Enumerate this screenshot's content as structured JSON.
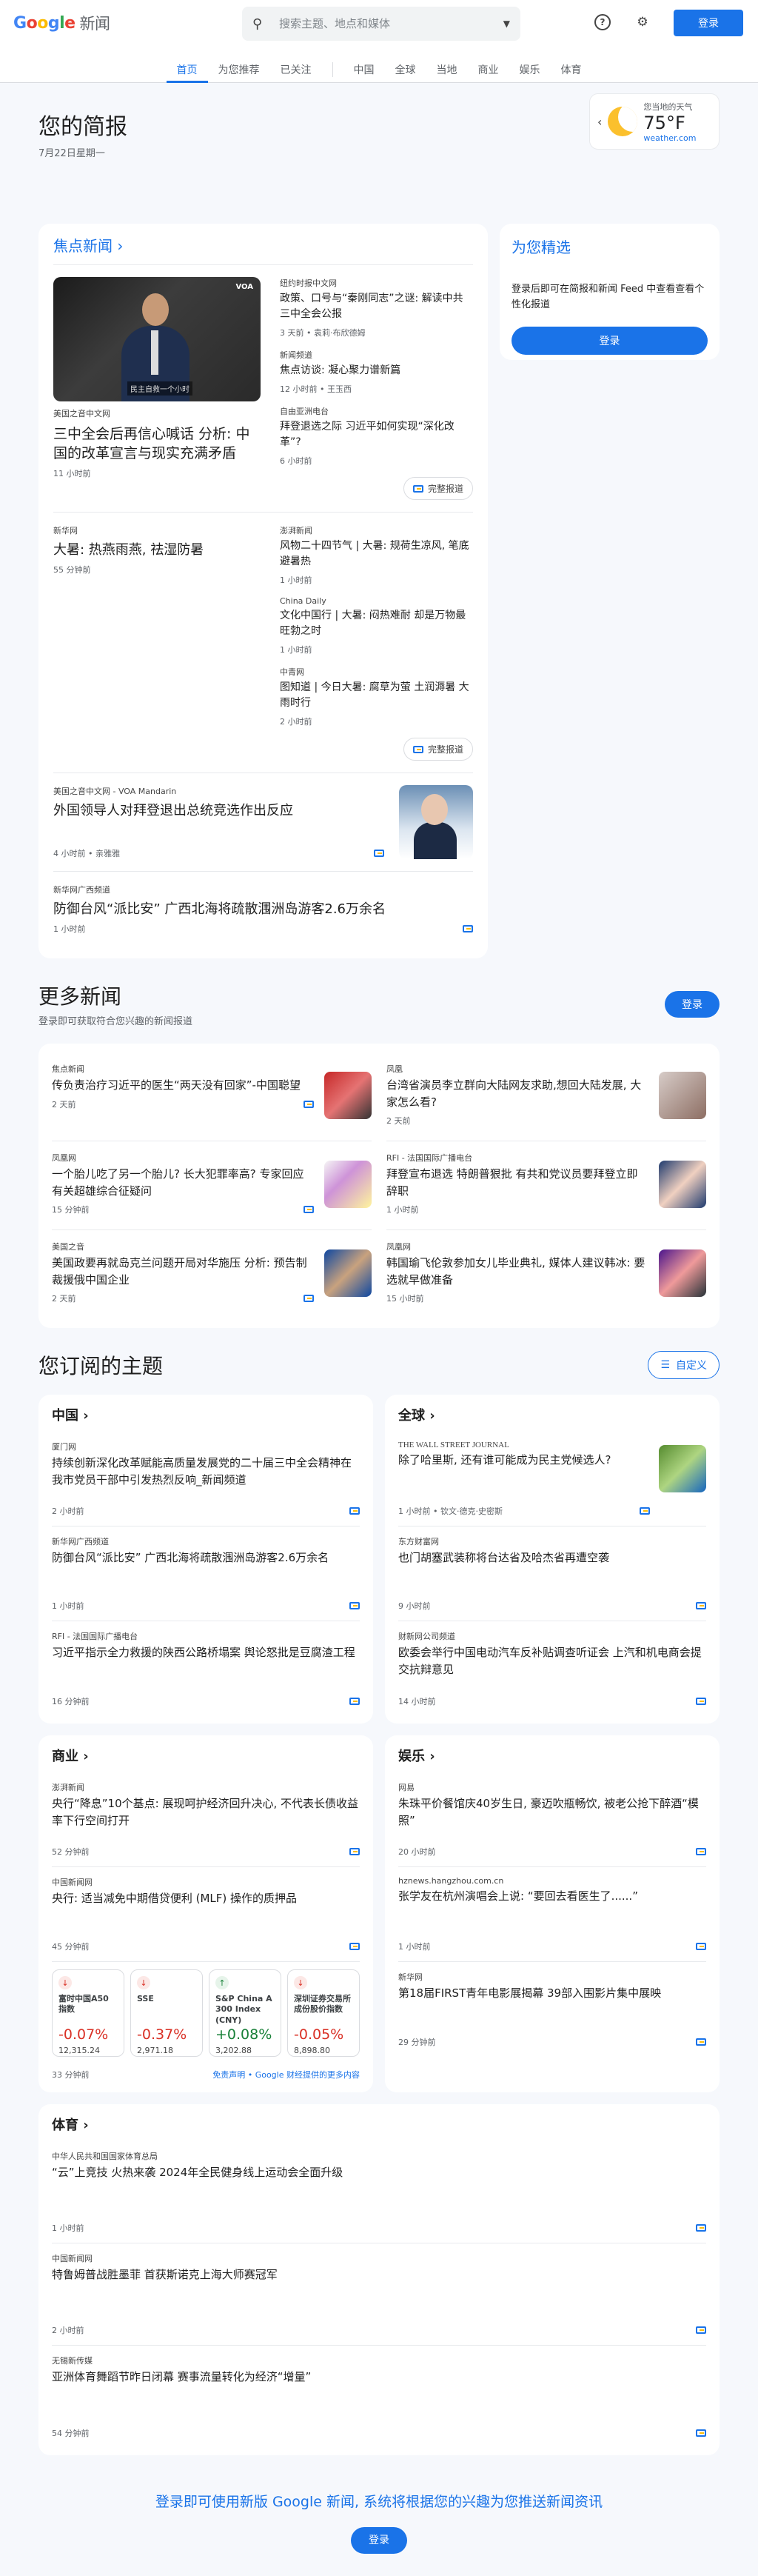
{
  "header": {
    "logo_google": "Google",
    "logo_news": "新闻",
    "search_placeholder": "搜索主题、地点和媒体",
    "login": "登录"
  },
  "nav": [
    {
      "label": "首页"
    },
    {
      "label": "为您推荐"
    },
    {
      "label": "已关注"
    },
    {
      "label": "中国"
    },
    {
      "label": "全球"
    },
    {
      "label": "当地"
    },
    {
      "label": "商业"
    },
    {
      "label": "娱乐"
    },
    {
      "label": "体育"
    }
  ],
  "briefing": {
    "title": "您的简报",
    "date": "7月22日星期一"
  },
  "weather": {
    "place": "您当地的天气",
    "temp": "75°F",
    "source": "weather.com"
  },
  "top": {
    "title": "焦点新闻",
    "c1": {
      "video_cap": "民主自救一个小时",
      "voa": "VOA",
      "main_src": "美国之音中文网",
      "main_hl": "三中全会后再信心喊话 分析: 中国的改革宣言与现实充满矛盾",
      "main_meta": "11 小时前",
      "s1_src": "纽约时报中文网",
      "s1_hl": "政策、口号与“秦刚同志”之谜: 解读中共三中全会公报",
      "s1_meta": "3 天前 • 袁莉·布欣德姆",
      "s2_src": "新闻频道",
      "s2_hl": "焦点访谈: 凝心聚力谱新篇",
      "s2_meta": "12 小时前 • 王玉西",
      "s3_src": "自由亚洲电台",
      "s3_hl": "拜登退选之际 习近平如何实现“深化改革”?",
      "s3_meta": "6 小时前",
      "full": "完整报道"
    },
    "c2": {
      "main_src": "新华网",
      "main_hl": "大暑: 热燕雨燕, 祛湿防暑",
      "main_meta": "55 分钟前",
      "s1_src": "澎湃新闻",
      "s1_hl": "风物二十四节气 | 大暑: 规荷生凉风, 笔底避暑热",
      "s1_meta": "1 小时前",
      "s2_src": "China Daily",
      "s2_hl": "文化中国行 | 大暑: 闷热难耐 却是万物最旺勃之时",
      "s2_meta": "1 小时前",
      "s3_src": "中青网",
      "s3_hl": "图知道 | 今日大暑: 腐草为萤 土润溽暑 大雨时行",
      "s3_meta": "2 小时前",
      "full": "完整报道"
    },
    "w1": {
      "src": "美国之音中文网 - VOA Mandarin",
      "hl": "外国领导人对拜登退出总统竞选作出反应",
      "meta": "4 小时前 • 亲雅雅"
    },
    "w2": {
      "src": "新华网广西频道",
      "hl": "防御台风“派比安” 广西北海将疏散涠洲岛游客2.6万余名",
      "meta": "1 小时前"
    }
  },
  "foryou": {
    "title": "为您精选",
    "text": "登录后即可在简报和新闻 Feed 中查看查看个性化报道",
    "btn": "登录"
  },
  "more": {
    "title": "更多新闻",
    "sub": "登录即可获取符合您兴趣的新闻报道",
    "btn": "登录",
    "items": [
      {
        "src": "焦点新闻",
        "hl": "传负责治疗习近平的医生“两天没有回家”-中国聪望",
        "meta": "2 天前"
      },
      {
        "src": "凤凰",
        "hl": "台湾省演员李立群向大陆网友求助,想回大陆发展, 大家怎么看?",
        "meta": "2 天前"
      },
      {
        "src": "凤凰网",
        "hl": "一个胎儿吃了另一个胎儿? 长大犯罪率高? 专家回应有关超雄综合征疑问",
        "meta": "15 分钟前"
      },
      {
        "src": "RFI - 法国国际广播电台",
        "hl": "拜登宣布退选 特朗普狠批 有共和党议员要拜登立即辞职",
        "meta": "1 小时前"
      },
      {
        "src": "美国之音",
        "hl": "美国政要再就岛克兰问题开局对华施压 分析: 预告制裁援俄中国企业",
        "meta": "2 天前"
      },
      {
        "src": "凤凰网",
        "hl": "韩国瑜飞伦敦参加女儿毕业典礼, 媒体人建议韩冰: 要选就早做准备",
        "meta": "15 小时前"
      }
    ]
  },
  "topics": {
    "title": "您订阅的主题",
    "customize": "自定义",
    "china": {
      "title": "中国",
      "items": [
        {
          "src": "厦门网",
          "hl": "持续创新深化改革赋能高质量发展党的二十届三中全会精神在我市党员干部中引发热烈反响_新闻频道",
          "meta": "2 小时前"
        },
        {
          "src": "新华网广西频道",
          "hl": "防御台风“派比安” 广西北海将疏散涠洲岛游客2.6万余名",
          "meta": "1 小时前"
        },
        {
          "src": "RFI - 法国国际广播电台",
          "hl": "习近平指示全力救援的陕西公路桥塌案 舆论怒批是豆腐渣工程",
          "meta": "16 分钟前"
        }
      ]
    },
    "global": {
      "title": "全球",
      "items": [
        {
          "src": "THE WALL STREET JOURNAL",
          "hl": "除了哈里斯, 还有谁可能成为民主党候选人?",
          "meta": "1 小时前 • 钦文·德克·史密斯"
        },
        {
          "src": "东方财富网",
          "hl": "也门胡塞武装称将台达省及哈杰省再遭空袭",
          "meta": "9 小时前"
        },
        {
          "src": "财新网公司频道",
          "hl": "欧委会举行中国电动汽车反补贴调查听证会 上汽和机电商会提交抗辩意见",
          "meta": "14 小时前"
        }
      ]
    },
    "business": {
      "title": "商业",
      "items": [
        {
          "src": "澎湃新闻",
          "hl": "央行“降息”10个基点: 展现呵护经济回升决心, 不代表长债收益率下行空间打开",
          "meta": "52 分钟前"
        },
        {
          "src": "中国新闻网",
          "hl": "央行: 适当减免中期借贷便利 (MLF) 操作的质押品",
          "meta": "45 分钟前"
        }
      ],
      "markets": [
        {
          "name": "富时中国A50 指数",
          "pct": "-0.07%",
          "val": "12,315.24",
          "dir": "down"
        },
        {
          "name": "SSE",
          "pct": "-0.37%",
          "val": "2,971.18",
          "dir": "down"
        },
        {
          "name": "S&P China A 300 Index (CNY)",
          "pct": "+0.08%",
          "val": "3,202.88",
          "dir": "up"
        },
        {
          "name": "深圳证券交易所成份股价指数",
          "pct": "-0.05%",
          "val": "8,898.80",
          "dir": "down"
        }
      ],
      "market_meta": "33 分钟前",
      "disclaimer": "免责声明 • Google 财经提供的更多内容"
    },
    "ent": {
      "title": "娱乐",
      "items": [
        {
          "src": "网易",
          "hl": "朱珠平价餐馆庆40岁生日, 豪迈吹瓶畅饮, 被老公抢下醉酒“模照”",
          "meta": "20 小时前"
        },
        {
          "src": "hznews.hangzhou.com.cn",
          "hl": "张学友在杭州演唱会上说: “要回去看医生了......”",
          "meta": "1 小时前"
        },
        {
          "src": "新华网",
          "hl": "第18届FIRST青年电影展揭幕 39部入围影片集中展映",
          "meta": "29 分钟前"
        }
      ]
    },
    "sports": {
      "title": "体育",
      "items": [
        {
          "src": "中华人民共和国国家体育总局",
          "hl": "“云”上竞技 火热来袭 2024年全民健身线上运动会全面升级",
          "meta": "1 小时前"
        },
        {
          "src": "中国新闻网",
          "hl": "特鲁姆普战胜墨菲 首获斯诺克上海大师赛冠军",
          "meta": "2 小时前"
        },
        {
          "src": "无锡新传媒",
          "hl": "亚洲体育舞蹈节昨日闭幕 赛事流量转化为经济“增量”",
          "meta": "54 分钟前"
        }
      ]
    }
  },
  "footer": {
    "text": "登录即可使用新版 Google 新闻, 系统将根据您的兴趣为您推送新闻资讯",
    "btn": "登录"
  }
}
